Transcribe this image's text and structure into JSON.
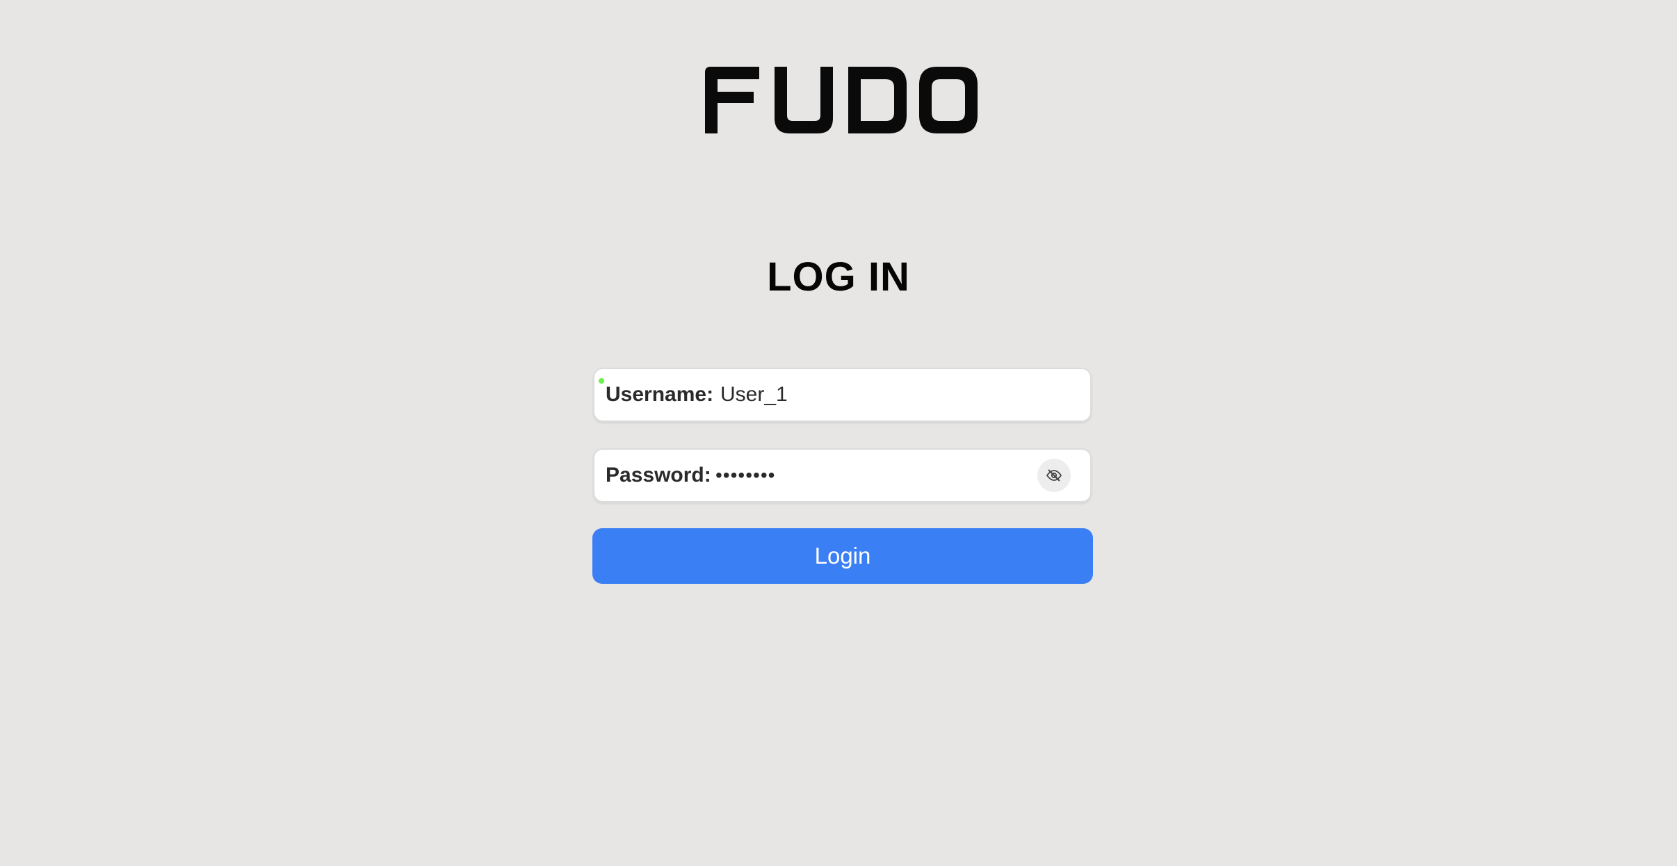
{
  "brand": {
    "logo_text": "FUDO"
  },
  "login": {
    "title": "LOG IN",
    "username_label": "Username:",
    "username_value": "User_1",
    "password_label": "Password:",
    "password_value": "••••••••",
    "toggle_visibility_icon": "eye-off-icon",
    "submit_label": "Login"
  },
  "colors": {
    "background": "#e7e6e4",
    "accent": "#3b7ff5",
    "focus_indicator": "#6cf04a"
  }
}
